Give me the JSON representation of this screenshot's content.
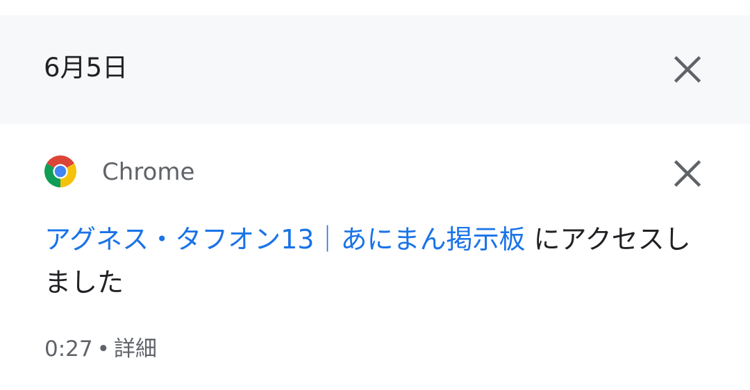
{
  "date_header": {
    "date": "6月5日"
  },
  "notification": {
    "app_name": "Chrome",
    "link_text": "アグネス・タフオン13｜あにまん掲示板",
    "message_suffix": " にアクセスしました",
    "time": "0:27",
    "separator": "•",
    "detail_label": "詳細"
  },
  "colors": {
    "header_bg": "#f7f8fa",
    "link": "#1a73e8",
    "text_primary": "#202124",
    "text_secondary": "#5f6368"
  },
  "icons": {
    "app": "chrome-icon",
    "dismiss": "close-icon"
  }
}
